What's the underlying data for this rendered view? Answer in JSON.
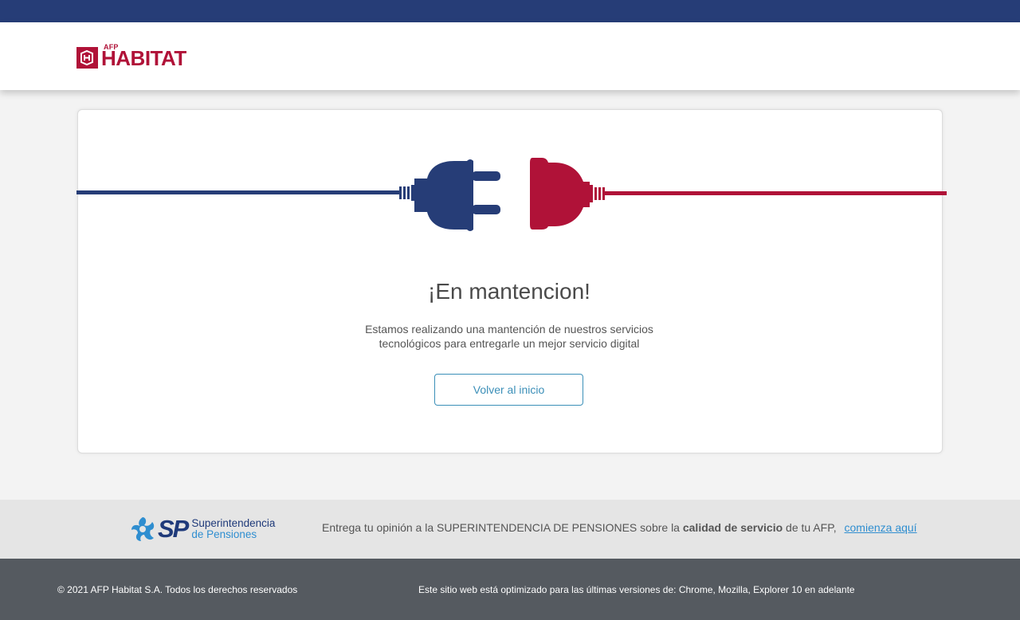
{
  "brand": {
    "prefix": "AFP",
    "name": "HABITAT",
    "colors": {
      "primary": "#b01238",
      "secondary": "#263d77"
    }
  },
  "illustration": {
    "icon": "unplugged-power-cable-icon",
    "left_color": "#263d77",
    "right_color": "#b01238"
  },
  "main": {
    "title": "¡En mantencion!",
    "message": "Estamos realizando una mantención de nuestros servicios tecnológicos para entregarle un mejor servicio digital",
    "button_label": "Volver al inicio"
  },
  "superintendencia": {
    "logo_letters": "SP",
    "logo_line1": "Superintendencia",
    "logo_line2": "de Pensiones",
    "opinion_prefix": "Entrega tu opinión a la SUPERINTENDENCIA DE PENSIONES sobre la ",
    "opinion_bold": "calidad de servicio",
    "opinion_suffix": " de tu AFP,",
    "link_label": "comienza aquí"
  },
  "footer": {
    "copyright": "© 2021 AFP Habitat S.A. Todos los derechos reservados",
    "browsers": "Este sitio web está optimizado para las últimas versiones de: Chrome, Mozilla, Explorer 10 en adelante"
  }
}
